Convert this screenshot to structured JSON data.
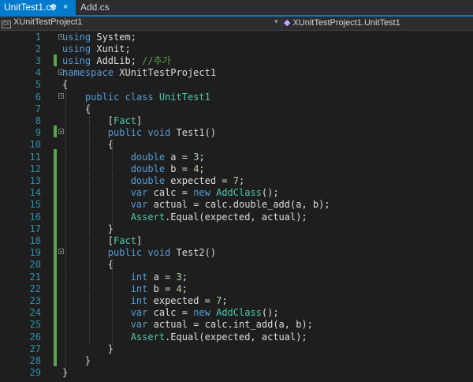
{
  "tabs": [
    {
      "label": "UnitTest1.cs",
      "active": true,
      "pin": "⊕",
      "close": "×"
    },
    {
      "label": "Add.cs",
      "active": false
    }
  ],
  "nav": {
    "left_label": "XUnitTestProject1",
    "right_label": "XUnitTestProject1.UnitTest1"
  },
  "colors": {
    "keyword": "#569cd6",
    "type": "#4ec9b0",
    "comment": "#57a64a",
    "number": "#b5cea8",
    "text": "#dcdcdc",
    "line_number": "#2b91af",
    "accent": "#007acc"
  },
  "lines": [
    [
      [
        "kw",
        "using"
      ],
      [
        "tx",
        " System;"
      ]
    ],
    [
      [
        "kw",
        "using"
      ],
      [
        "tx",
        " Xunit;"
      ]
    ],
    [
      [
        "kw",
        "using"
      ],
      [
        "tx",
        " AddLib; "
      ],
      [
        "cm",
        "//추가"
      ]
    ],
    [
      [
        "kw",
        "namespace"
      ],
      [
        "tx",
        " XUnitTestProject1"
      ]
    ],
    [
      [
        "tx",
        "{"
      ]
    ],
    [
      [
        "tx",
        "    "
      ],
      [
        "kw",
        "public"
      ],
      [
        "tx",
        " "
      ],
      [
        "kw",
        "class"
      ],
      [
        "tx",
        " "
      ],
      [
        "ty",
        "UnitTest1"
      ]
    ],
    [
      [
        "tx",
        "    {"
      ]
    ],
    [
      [
        "tx",
        "        ["
      ],
      [
        "ty",
        "Fact"
      ],
      [
        "tx",
        "]"
      ]
    ],
    [
      [
        "tx",
        "        "
      ],
      [
        "kw",
        "public"
      ],
      [
        "tx",
        " "
      ],
      [
        "kw",
        "void"
      ],
      [
        "tx",
        " Test1()"
      ]
    ],
    [
      [
        "tx",
        "        {"
      ]
    ],
    [
      [
        "tx",
        "            "
      ],
      [
        "kw",
        "double"
      ],
      [
        "tx",
        " a = "
      ],
      [
        "num",
        "3"
      ],
      [
        "tx",
        ";"
      ]
    ],
    [
      [
        "tx",
        "            "
      ],
      [
        "kw",
        "double"
      ],
      [
        "tx",
        " b = "
      ],
      [
        "num",
        "4"
      ],
      [
        "tx",
        ";"
      ]
    ],
    [
      [
        "tx",
        "            "
      ],
      [
        "kw",
        "double"
      ],
      [
        "tx",
        " expected = "
      ],
      [
        "num",
        "7"
      ],
      [
        "tx",
        ";"
      ]
    ],
    [
      [
        "tx",
        "            "
      ],
      [
        "kw",
        "var"
      ],
      [
        "tx",
        " calc = "
      ],
      [
        "kw",
        "new"
      ],
      [
        "tx",
        " "
      ],
      [
        "ty",
        "AddClass"
      ],
      [
        "tx",
        "();"
      ]
    ],
    [
      [
        "tx",
        "            "
      ],
      [
        "kw",
        "var"
      ],
      [
        "tx",
        " actual = calc.double_add(a, b);"
      ]
    ],
    [
      [
        "tx",
        "            "
      ],
      [
        "ty",
        "Assert"
      ],
      [
        "tx",
        ".Equal(expected, actual);"
      ]
    ],
    [
      [
        "tx",
        "        }"
      ]
    ],
    [
      [
        "tx",
        "        ["
      ],
      [
        "ty",
        "Fact"
      ],
      [
        "tx",
        "]"
      ]
    ],
    [
      [
        "tx",
        "        "
      ],
      [
        "kw",
        "public"
      ],
      [
        "tx",
        " "
      ],
      [
        "kw",
        "void"
      ],
      [
        "tx",
        " Test2()"
      ]
    ],
    [
      [
        "tx",
        "        {"
      ]
    ],
    [
      [
        "tx",
        "            "
      ],
      [
        "kw",
        "int"
      ],
      [
        "tx",
        " a = "
      ],
      [
        "num",
        "3"
      ],
      [
        "tx",
        ";"
      ]
    ],
    [
      [
        "tx",
        "            "
      ],
      [
        "kw",
        "int"
      ],
      [
        "tx",
        " b = "
      ],
      [
        "num",
        "4"
      ],
      [
        "tx",
        ";"
      ]
    ],
    [
      [
        "tx",
        "            "
      ],
      [
        "kw",
        "int"
      ],
      [
        "tx",
        " expected = "
      ],
      [
        "num",
        "7"
      ],
      [
        "tx",
        ";"
      ]
    ],
    [
      [
        "tx",
        "            "
      ],
      [
        "kw",
        "var"
      ],
      [
        "tx",
        " calc = "
      ],
      [
        "kw",
        "new"
      ],
      [
        "tx",
        " "
      ],
      [
        "ty",
        "AddClass"
      ],
      [
        "tx",
        "();"
      ]
    ],
    [
      [
        "tx",
        "            "
      ],
      [
        "kw",
        "var"
      ],
      [
        "tx",
        " actual = calc.int_add(a, b);"
      ]
    ],
    [
      [
        "tx",
        "            "
      ],
      [
        "ty",
        "Assert"
      ],
      [
        "tx",
        ".Equal(expected, actual);"
      ]
    ],
    [
      [
        "tx",
        "        }"
      ]
    ],
    [
      [
        "tx",
        "    }"
      ]
    ],
    [
      [
        "tx",
        "}"
      ]
    ]
  ]
}
